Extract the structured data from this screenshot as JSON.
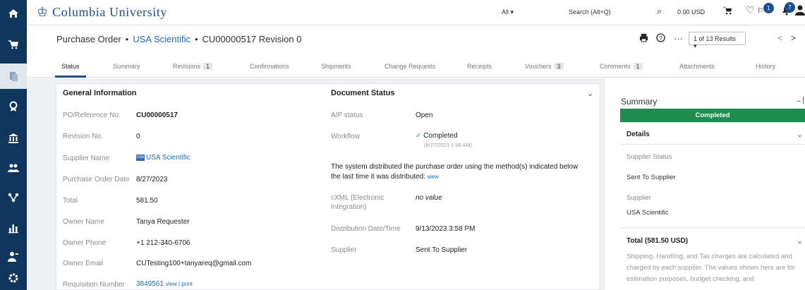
{
  "app": {
    "university_name": "Columbia University"
  },
  "topbar": {
    "search_scope": "All ▾",
    "search_placeholder": "Search (Alt+Q)",
    "cart_total": "0.00 USD",
    "flag_badge": "1",
    "bell_badge": "7"
  },
  "rail": {
    "icons": [
      "home-icon",
      "cart-icon",
      "documents-icon",
      "award-icon",
      "bank-icon",
      "users-icon",
      "org-icon",
      "chart-icon",
      "person-key-icon",
      "settings-icon"
    ]
  },
  "header": {
    "title_prefix": "Purchase Order",
    "supplier_link": "USA Scientific",
    "po_number": "CU00000517 Revision 0",
    "results": "1 of 13 Results ▾"
  },
  "tabs": [
    {
      "label": "Status"
    },
    {
      "label": "Summary"
    },
    {
      "label": "Revisions",
      "count": "1"
    },
    {
      "label": "Confirmations"
    },
    {
      "label": "Shipments"
    },
    {
      "label": "Change Requests"
    },
    {
      "label": "Receipts"
    },
    {
      "label": "Vouchers",
      "count": "3"
    },
    {
      "label": "Comments",
      "count": "1"
    },
    {
      "label": "Attachments"
    },
    {
      "label": "History"
    }
  ],
  "general_info": {
    "title": "General Information",
    "fields": [
      {
        "label": "PO/Reference No.",
        "value": "CU00000517"
      },
      {
        "label": "Revision No.",
        "value": "0"
      },
      {
        "label": "Supplier Name",
        "value": "USA Scientific",
        "logo_text": "USA"
      },
      {
        "label": "Purchase Order Date",
        "value": "8/27/2023"
      },
      {
        "label": "Total",
        "value": "581.50"
      },
      {
        "label": "Owner Name",
        "value": "Tanya Requester"
      },
      {
        "label": "Owner Phone",
        "value": "+1 212-340-6706"
      },
      {
        "label": "Owner Email",
        "value": "CUTesting100+tanyareq@gmail.com"
      },
      {
        "label": "Requisition Number",
        "value": "3849561",
        "links": [
          "view",
          "print"
        ]
      }
    ]
  },
  "document_status": {
    "title": "Document Status",
    "ap_status_label": "A/P status",
    "ap_status_value": "Open",
    "workflow_label": "Workflow",
    "workflow_value": "Completed",
    "workflow_date": "(8/27/2023 1:58 AM)",
    "distribution_note": "The system distributed the purchase order using the method(s) indicated below the last time it was distributed:",
    "distribution_view_link": "view",
    "cxml_label": "cXML (Electronic Integration)",
    "cxml_value": "no value",
    "dist_date_label": "Distribution Date/Time",
    "dist_date_value": "9/13/2023 3:58 PM",
    "supplier_label": "Supplier",
    "supplier_value": "Sent To Supplier"
  },
  "summary_panel": {
    "title": "Summary",
    "status_banner": "Completed",
    "details_heading": "Details",
    "supplier_status_label": "Supplier Status",
    "supplier_status_value": "Sent To Supplier",
    "supplier_label": "Supplier",
    "supplier_value": "USA Scientific",
    "total_heading": "Total (581.50 USD)",
    "total_note": "Shipping, Handling, and Tax charges are calculated and charged by each supplier. The values shown here are for estimation purposes, budget checking, and"
  },
  "colors": {
    "rail_bg": "#11365e",
    "brand_blue": "#1d4f91",
    "link_blue": "#1d6bb5",
    "completed_green": "#1e8c4d",
    "workflow_check": "#2e9a4f"
  }
}
